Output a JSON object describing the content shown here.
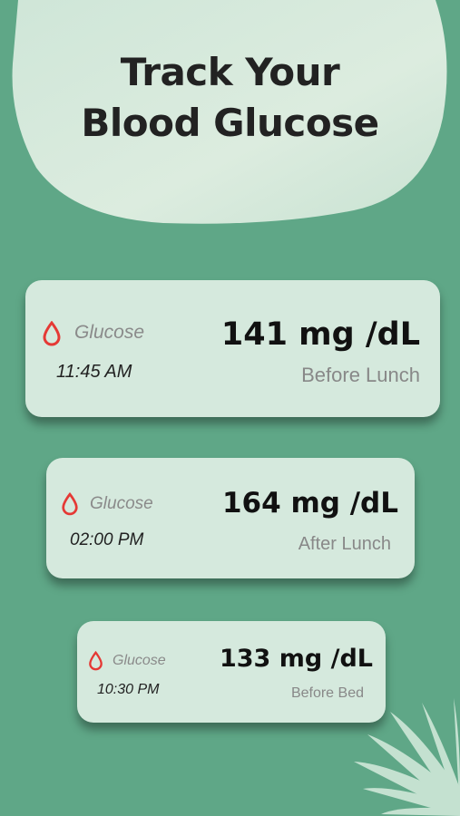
{
  "header": {
    "line1": "Track Your",
    "line2": "Blood Glucose"
  },
  "readings": [
    {
      "label": "Glucose",
      "time": "11:45 AM",
      "value": "141 mg /dL",
      "context": "Before Lunch"
    },
    {
      "label": "Glucose",
      "time": "02:00 PM",
      "value": "164 mg /dL",
      "context": "After Lunch"
    },
    {
      "label": "Glucose",
      "time": "10:30 PM",
      "value": "133 mg /dL",
      "context": "Before Bed"
    }
  ],
  "colors": {
    "background": "#5fa787",
    "card": "#d5e9dd",
    "blob": "#d8ebe0",
    "drop": "#e53935"
  },
  "icons": {
    "reading_icon": "blood-drop-icon"
  }
}
